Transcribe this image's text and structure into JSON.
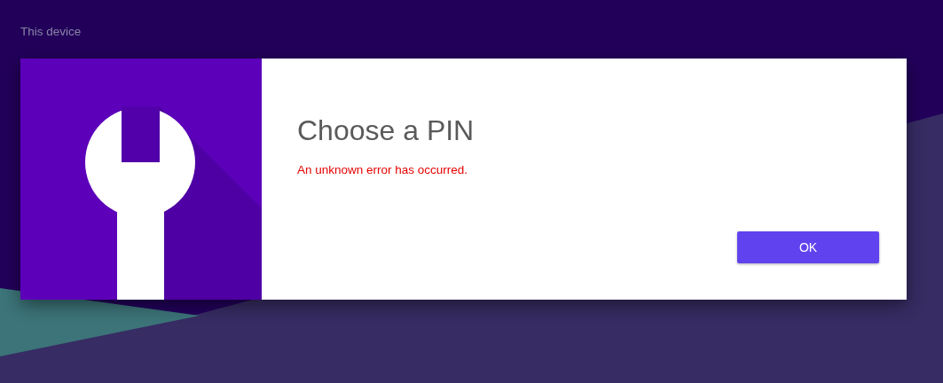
{
  "header": {
    "label": "This device"
  },
  "dialog": {
    "title": "Choose a PIN",
    "error": "An unknown error has occurred.",
    "buttons": [
      {
        "label": "OK"
      }
    ]
  }
}
